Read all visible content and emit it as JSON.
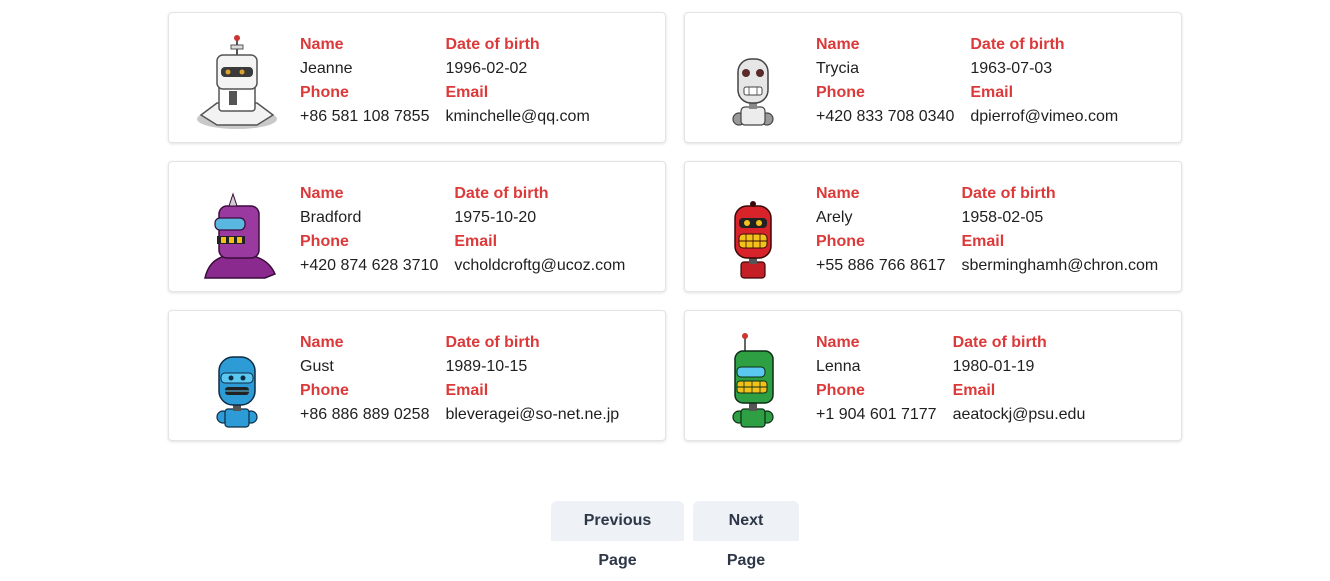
{
  "labels": {
    "name": "Name",
    "dob": "Date of birth",
    "phone": "Phone",
    "email": "Email"
  },
  "users": [
    {
      "name": "Jeanne",
      "dob": "1996-02-02",
      "phone": "+86 581 108 7855",
      "email": "kminchelle@qq.com",
      "avatar": "white-robot-icon",
      "color": "#e8e8e8"
    },
    {
      "name": "Trycia",
      "dob": "1963-07-03",
      "phone": "+420 833 708 0340",
      "email": "dpierrof@vimeo.com",
      "avatar": "grey-robot-icon",
      "color": "#d9d9d9"
    },
    {
      "name": "Bradford",
      "dob": "1975-10-20",
      "phone": "+420 874 628 3710",
      "email": "vcholdcroftg@ucoz.com",
      "avatar": "purple-robot-icon",
      "color": "#8a2a8e"
    },
    {
      "name": "Arely",
      "dob": "1958-02-05",
      "phone": "+55 886 766 8617",
      "email": "sberminghamh@chron.com",
      "avatar": "red-robot-icon",
      "color": "#d8232a"
    },
    {
      "name": "Gust",
      "dob": "1989-10-15",
      "phone": "+86 886 889 0258",
      "email": "bleveragei@so-net.ne.jp",
      "avatar": "blue-robot-icon",
      "color": "#2d9bd6"
    },
    {
      "name": "Lenna",
      "dob": "1980-01-19",
      "phone": "+1 904 601 7177",
      "email": "aeatockj@psu.edu",
      "avatar": "green-robot-icon",
      "color": "#2ea043"
    }
  ],
  "pagination": {
    "previous": "Previous Page",
    "next": "Next Page"
  }
}
